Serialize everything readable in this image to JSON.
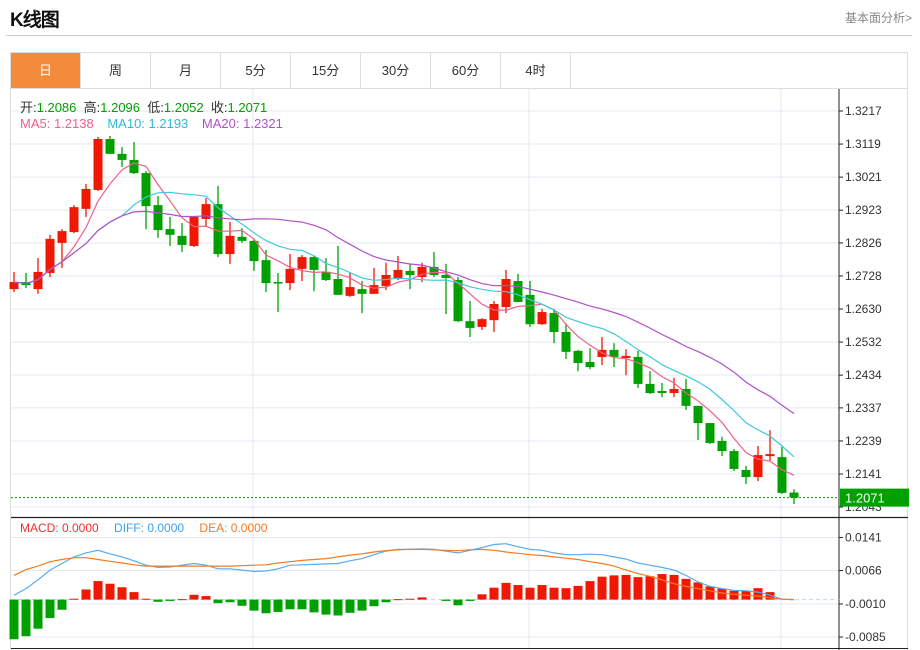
{
  "header": {
    "title": "K线图",
    "link": "基本面分析>"
  },
  "tabs": [
    {
      "label": "日",
      "active": true
    },
    {
      "label": "周"
    },
    {
      "label": "月"
    },
    {
      "label": "5分"
    },
    {
      "label": "15分"
    },
    {
      "label": "30分"
    },
    {
      "label": "60分"
    },
    {
      "label": "4时"
    }
  ],
  "ohlc_legend": {
    "open_label": "开:",
    "open": "1.2086",
    "high_label": "高:",
    "high": "1.2096",
    "low_label": "低:",
    "low": "1.2052",
    "close_label": "收:",
    "close": "1.2071"
  },
  "ma_legend": {
    "ma5": "MA5: 1.2138",
    "ma10": "MA10: 1.2193",
    "ma20": "MA20: 1.2321"
  },
  "macd_legend": {
    "macd": "MACD: 0.0000",
    "diff": "DIFF: 0.0000",
    "dea": "DEA: 0.0000"
  },
  "colors": {
    "up": "#f01800",
    "down": "#00a000",
    "ma5": "#f0608a",
    "ma10": "#40c8e0",
    "ma20": "#b050c8",
    "diff": "#5aaaf0",
    "dea": "#f57a20",
    "active_tab": "#f28b3c",
    "last_price": "#00a000"
  },
  "chart_data": {
    "type": "candlestick",
    "price_axis": {
      "ticks": [
        "1.3217",
        "1.3119",
        "1.3021",
        "1.2923",
        "1.2826",
        "1.2728",
        "1.2630",
        "1.2532",
        "1.2434",
        "1.2337",
        "1.2239",
        "1.2141",
        "1.2043"
      ],
      "range": [
        1.2043,
        1.3217
      ]
    },
    "last_price": "1.2071",
    "candles": [
      [
        1.2689,
        1.274,
        1.268,
        1.271
      ],
      [
        1.271,
        1.2737,
        1.2692,
        1.2701
      ],
      [
        1.2689,
        1.2781,
        1.2675,
        1.274
      ],
      [
        1.2737,
        1.285,
        1.2725,
        1.2838
      ],
      [
        1.2826,
        1.2867,
        1.2752,
        1.2861
      ],
      [
        1.2858,
        1.2938,
        1.2855,
        1.2932
      ],
      [
        1.2927,
        1.3001,
        1.2903,
        1.2986
      ],
      [
        1.2983,
        1.314,
        1.298,
        1.3134
      ],
      [
        1.3134,
        1.3143,
        1.309,
        1.309
      ],
      [
        1.309,
        1.311,
        1.3051,
        1.3072
      ],
      [
        1.3072,
        1.3125,
        1.303,
        1.3033
      ],
      [
        1.3033,
        1.3039,
        1.2867,
        1.2935
      ],
      [
        1.2938,
        1.2965,
        1.2841,
        1.2864
      ],
      [
        1.2867,
        1.2903,
        1.2817,
        1.285
      ],
      [
        1.2847,
        1.2885,
        1.2799,
        1.282
      ],
      [
        1.2817,
        1.2906,
        1.2814,
        1.2903
      ],
      [
        1.2897,
        1.2959,
        1.2873,
        1.2941
      ],
      [
        1.2941,
        1.2995,
        1.2784,
        1.2793
      ],
      [
        1.2793,
        1.2888,
        1.2764,
        1.2847
      ],
      [
        1.2844,
        1.287,
        1.2826,
        1.2832
      ],
      [
        1.2832,
        1.2838,
        1.2743,
        1.2772
      ],
      [
        1.2775,
        1.2805,
        1.268,
        1.2707
      ],
      [
        1.271,
        1.2737,
        1.2621,
        1.2707
      ],
      [
        1.2707,
        1.2793,
        1.2686,
        1.2749
      ],
      [
        1.2749,
        1.279,
        1.2713,
        1.2784
      ],
      [
        1.2784,
        1.2787,
        1.2683,
        1.2746
      ],
      [
        1.274,
        1.2781,
        1.2713,
        1.2716
      ],
      [
        1.2719,
        1.2817,
        1.2672,
        1.2672
      ],
      [
        1.2669,
        1.2737,
        1.2666,
        1.2695
      ],
      [
        1.2689,
        1.2713,
        1.2618,
        1.2675
      ],
      [
        1.2675,
        1.2752,
        1.2675,
        1.2701
      ],
      [
        1.2698,
        1.2767,
        1.2686,
        1.2731
      ],
      [
        1.2719,
        1.2787,
        1.2716,
        1.2746
      ],
      [
        1.2743,
        1.2764,
        1.2689,
        1.2731
      ],
      [
        1.2725,
        1.2767,
        1.271,
        1.2755
      ],
      [
        1.2755,
        1.2799,
        1.2725,
        1.2731
      ],
      [
        1.2731,
        1.2764,
        1.2615,
        1.2722
      ],
      [
        1.2716,
        1.2725,
        1.2591,
        1.2594
      ],
      [
        1.2594,
        1.2654,
        1.2547,
        1.2574
      ],
      [
        1.2577,
        1.2603,
        1.2568,
        1.26
      ],
      [
        1.2597,
        1.2654,
        1.2562,
        1.2645
      ],
      [
        1.2636,
        1.2746,
        1.2618,
        1.2719
      ],
      [
        1.2713,
        1.2734,
        1.2651,
        1.2651
      ],
      [
        1.2672,
        1.2713,
        1.2577,
        1.2585
      ],
      [
        1.2585,
        1.263,
        1.2583,
        1.2621
      ],
      [
        1.2618,
        1.263,
        1.2529,
        1.2562
      ],
      [
        1.2562,
        1.2588,
        1.2482,
        1.2503
      ],
      [
        1.2506,
        1.2509,
        1.2446,
        1.247
      ],
      [
        1.2473,
        1.2514,
        1.2452,
        1.2458
      ],
      [
        1.2488,
        1.2547,
        1.2464,
        1.2509
      ],
      [
        1.2509,
        1.2529,
        1.2458,
        1.2488
      ],
      [
        1.2485,
        1.2511,
        1.2434,
        1.2491
      ],
      [
        1.2488,
        1.2506,
        1.2396,
        1.2408
      ],
      [
        1.2408,
        1.2446,
        1.2378,
        1.2381
      ],
      [
        1.2387,
        1.2411,
        1.2369,
        1.2381
      ],
      [
        1.2381,
        1.2426,
        1.2369,
        1.2393
      ],
      [
        1.2393,
        1.2423,
        1.2331,
        1.2343
      ],
      [
        1.2343,
        1.2343,
        1.2242,
        1.2292
      ],
      [
        1.2292,
        1.2292,
        1.223,
        1.2233
      ],
      [
        1.2239,
        1.2251,
        1.2194,
        1.2209
      ],
      [
        1.2209,
        1.2215,
        1.215,
        1.2156
      ],
      [
        1.2153,
        1.2165,
        1.2111,
        1.2132
      ],
      [
        1.2132,
        1.2224,
        1.212,
        1.2197
      ],
      [
        1.2194,
        1.2271,
        1.218,
        1.22
      ],
      [
        1.2191,
        1.2221,
        1.2082,
        1.2085
      ],
      [
        1.2086,
        1.2096,
        1.2052,
        1.2071
      ]
    ],
    "macd_axis": {
      "ticks": [
        "0.0141",
        "0.0066",
        "-0.0010",
        "-0.0085"
      ],
      "range": [
        -0.01,
        0.016
      ]
    },
    "macd": [
      -0.009,
      -0.0083,
      -0.0066,
      -0.0042,
      -0.0023,
      0.0002,
      0.0023,
      0.0042,
      0.0036,
      0.0028,
      0.0017,
      0.0002,
      -0.0005,
      -0.0003,
      0.0001,
      0.0011,
      0.0008,
      -0.0008,
      -0.0006,
      -0.0014,
      -0.0025,
      -0.0031,
      -0.0028,
      -0.0022,
      -0.0022,
      -0.0029,
      -0.0034,
      -0.0036,
      -0.003,
      -0.0025,
      -0.0015,
      -0.0006,
      0.0001,
      0.0002,
      0.0005,
      0.0,
      -0.0003,
      -0.0013,
      -0.0003,
      0.0012,
      0.0027,
      0.0038,
      0.0033,
      0.0027,
      0.0033,
      0.0027,
      0.0026,
      0.0031,
      0.0042,
      0.0052,
      0.0055,
      0.0056,
      0.0051,
      0.0053,
      0.0058,
      0.0056,
      0.0047,
      0.0039,
      0.003,
      0.0025,
      0.002,
      0.002,
      0.0026,
      0.0017,
      0.0,
      0.0
    ],
    "diff": [
      0.001,
      0.0025,
      0.0045,
      0.0067,
      0.0082,
      0.0097,
      0.0106,
      0.0112,
      0.0104,
      0.0097,
      0.0088,
      0.0078,
      0.0073,
      0.0074,
      0.0078,
      0.0082,
      0.0078,
      0.007,
      0.007,
      0.0067,
      0.0064,
      0.0065,
      0.007,
      0.0078,
      0.0079,
      0.008,
      0.0081,
      0.0082,
      0.0088,
      0.0093,
      0.0102,
      0.011,
      0.0114,
      0.0114,
      0.0115,
      0.0114,
      0.011,
      0.0106,
      0.0112,
      0.0118,
      0.0125,
      0.0127,
      0.012,
      0.0114,
      0.0112,
      0.0106,
      0.0102,
      0.0102,
      0.0103,
      0.0102,
      0.0097,
      0.0092,
      0.0083,
      0.0078,
      0.0073,
      0.0067,
      0.0055,
      0.004,
      0.003,
      0.0025,
      0.0021,
      0.002,
      0.0017,
      0.001,
      0.0001,
      0.0
    ],
    "dea": [
      0.0055,
      0.0068,
      0.0076,
      0.0086,
      0.0091,
      0.0095,
      0.0095,
      0.0091,
      0.0087,
      0.0083,
      0.0079,
      0.0076,
      0.0076,
      0.0076,
      0.0076,
      0.0076,
      0.0076,
      0.0076,
      0.0076,
      0.0077,
      0.0078,
      0.0079,
      0.0083,
      0.0086,
      0.0089,
      0.0091,
      0.0093,
      0.0097,
      0.0101,
      0.0104,
      0.0108,
      0.0111,
      0.0113,
      0.0114,
      0.0114,
      0.0113,
      0.0112,
      0.0111,
      0.0113,
      0.0114,
      0.0112,
      0.0108,
      0.0105,
      0.0102,
      0.01,
      0.0097,
      0.0094,
      0.0091,
      0.0086,
      0.0082,
      0.0076,
      0.0067,
      0.0059,
      0.0053,
      0.0045,
      0.0036,
      0.003,
      0.0025,
      0.002,
      0.0015,
      0.0012,
      0.001,
      0.0008,
      0.0004,
      0.0001,
      0.0
    ]
  }
}
